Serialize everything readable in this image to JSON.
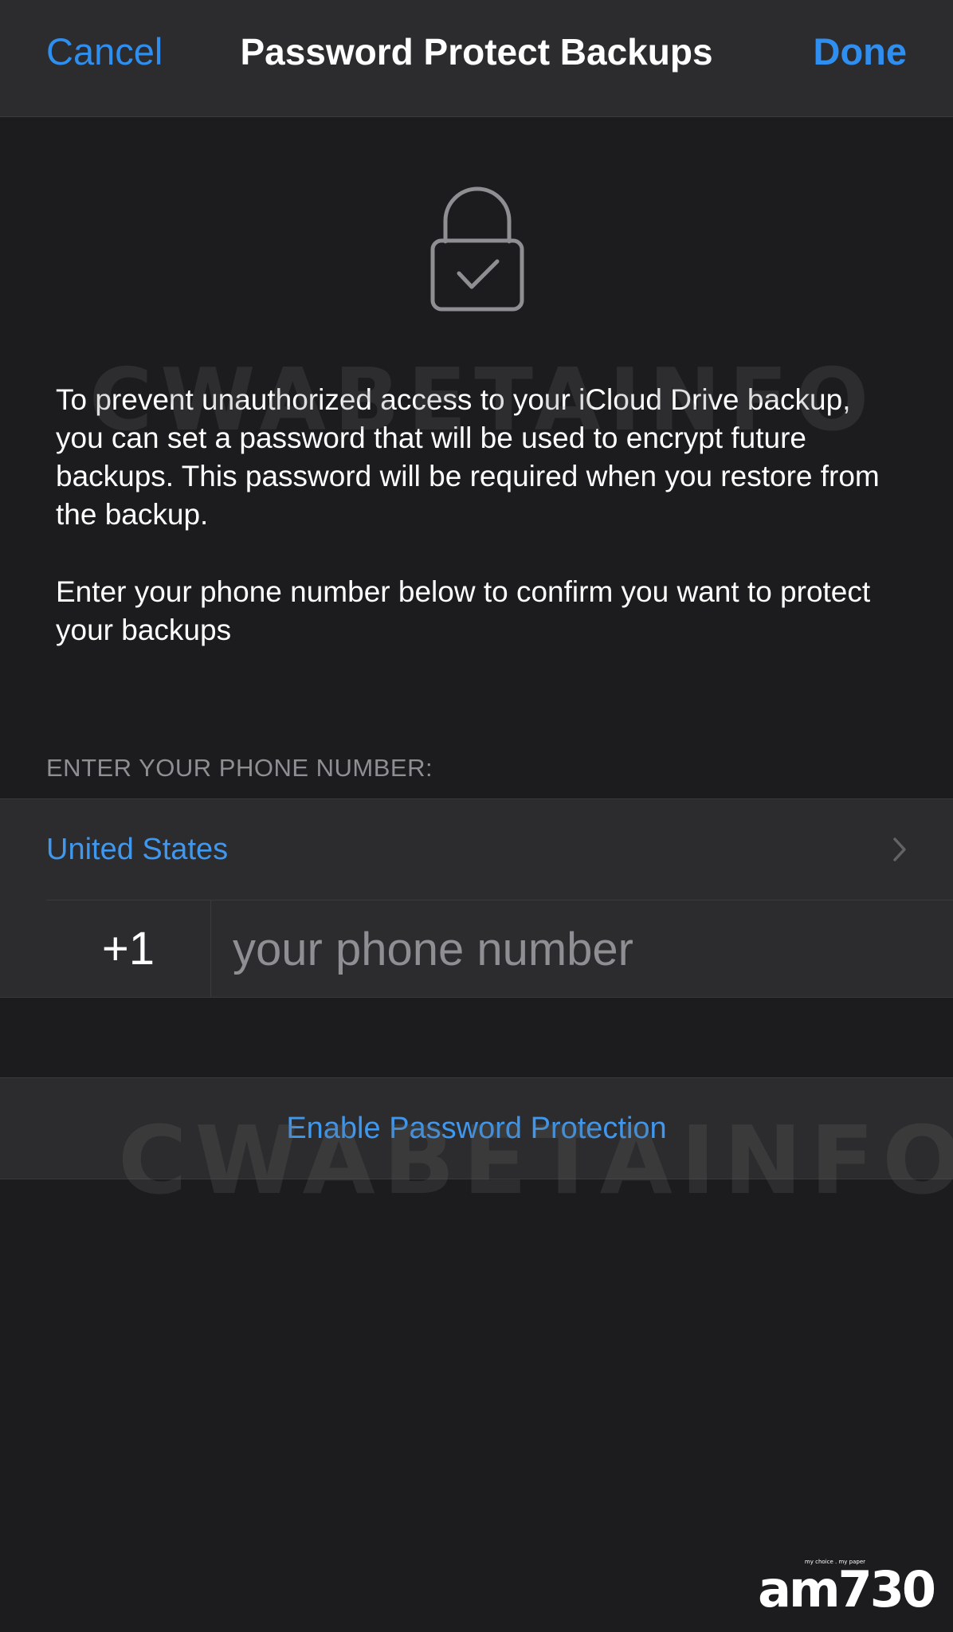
{
  "nav": {
    "cancel_label": "Cancel",
    "title": "Password Protect Backups",
    "done_label": "Done"
  },
  "icon": {
    "name": "lock-check-icon"
  },
  "description": "To prevent unauthorized access to your iCloud Drive backup, you can set a password that will be used to encrypt future backups. This password will be required when you restore from the backup.",
  "confirm_text": "Enter your phone number below to confirm you want to protect your backups",
  "phone": {
    "section_header": "ENTER YOUR PHONE NUMBER:",
    "country": "United States",
    "country_code": "+1",
    "number_value": "",
    "placeholder": "your phone number"
  },
  "action": {
    "enable_label": "Enable Password Protection"
  },
  "watermark": "CWABETAINFO",
  "corner_logo": {
    "text": "am730",
    "tagline": "my choice . my paper"
  },
  "colors": {
    "background": "#1c1c1e",
    "group_background": "#2c2c2e",
    "accent": "#2f8ff0",
    "secondary_text": "#8e8e93"
  }
}
